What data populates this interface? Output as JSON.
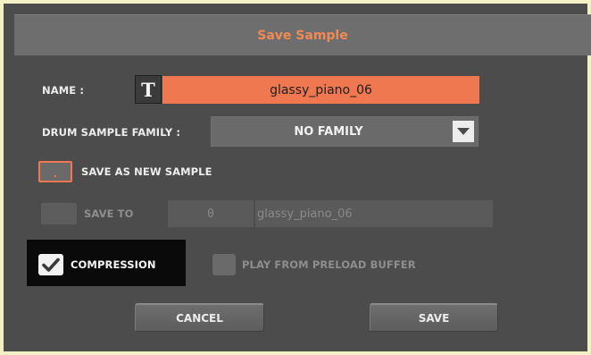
{
  "dialog": {
    "title": "Save Sample"
  },
  "name": {
    "label": "NAME :",
    "icon": "text-edit-icon",
    "icon_glyph": "T",
    "value": "glassy_piano_06"
  },
  "family": {
    "label": "DRUM SAMPLE FAMILY :",
    "selected": "NO FAMILY",
    "icon": "chevron-down-icon"
  },
  "save_as_new": {
    "label": "SAVE AS NEW SAMPLE",
    "checked": false
  },
  "save_to": {
    "label": "SAVE TO",
    "checked": false,
    "number": "0",
    "name": "glassy_piano_06"
  },
  "compression": {
    "label": "COMPRESSION",
    "checked": true,
    "icon": "checkmark-icon"
  },
  "preload": {
    "label": "PLAY FROM PRELOAD BUFFER",
    "checked": false
  },
  "buttons": {
    "cancel": "CANCEL",
    "save": "SAVE"
  },
  "colors": {
    "accent": "#f07850",
    "title_text": "#f08a55",
    "dialog_bg": "#4c4c4c",
    "titlebar_bg": "#6e6e6e",
    "outer_bg": "#f2f0c4"
  }
}
